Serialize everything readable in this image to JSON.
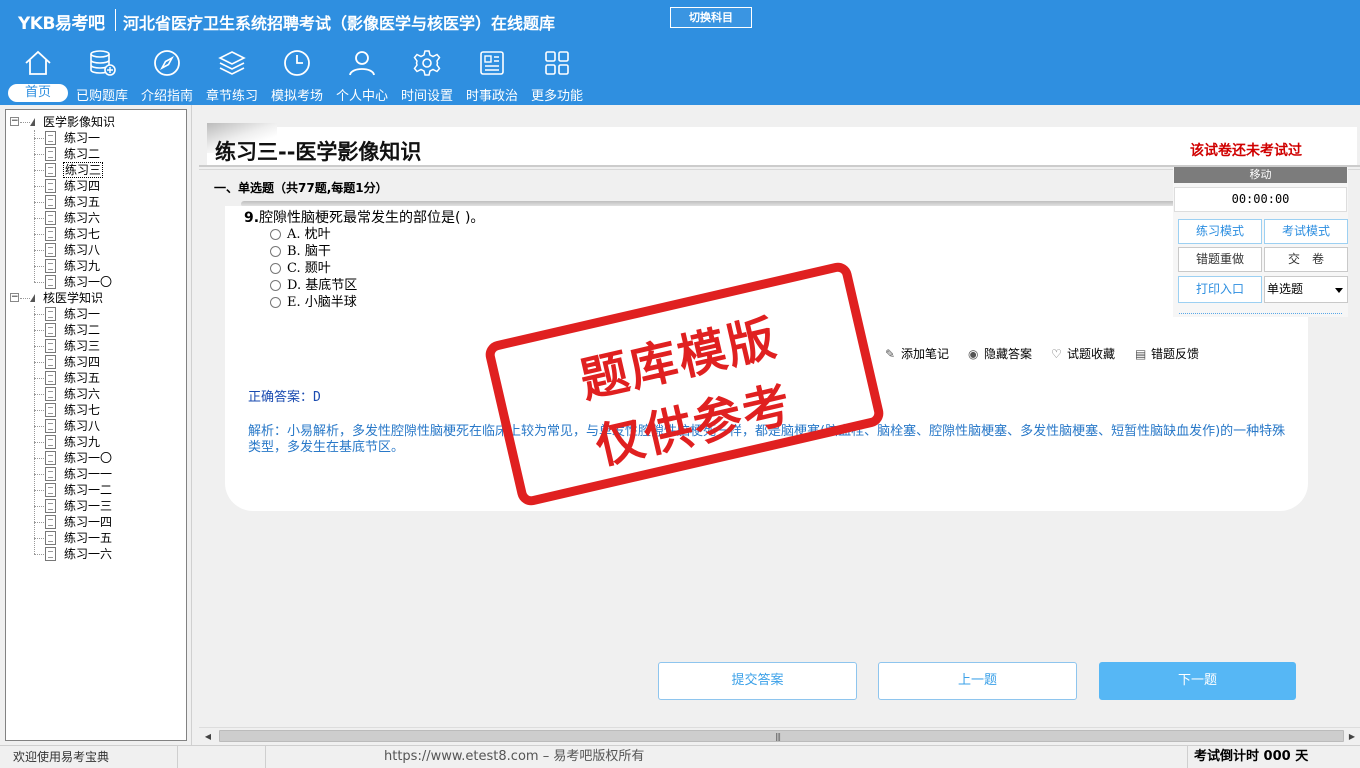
{
  "header": {
    "logo": "YKB易考吧",
    "title": "河北省医疗卫生系统招聘考试（影像医学与核医学）在线题库",
    "switch_subject": "切换科目"
  },
  "nav": [
    {
      "label": "首页",
      "icon": "home-icon",
      "active": true
    },
    {
      "label": "已购题库",
      "icon": "database-icon"
    },
    {
      "label": "介绍指南",
      "icon": "compass-icon"
    },
    {
      "label": "章节练习",
      "icon": "layers-icon"
    },
    {
      "label": "模拟考场",
      "icon": "clock-icon"
    },
    {
      "label": "个人中心",
      "icon": "user-icon"
    },
    {
      "label": "时间设置",
      "icon": "gear-icon"
    },
    {
      "label": "时事政治",
      "icon": "news-icon"
    },
    {
      "label": "更多功能",
      "icon": "grid-icon"
    }
  ],
  "tree": {
    "groups": [
      {
        "label": "医学影像知识",
        "items": [
          "练习一",
          "练习二",
          "练习三",
          "练习四",
          "练习五",
          "练习六",
          "练习七",
          "练习八",
          "练习九",
          "练习一〇"
        ]
      },
      {
        "label": "核医学知识",
        "items": [
          "练习一",
          "练习二",
          "练习三",
          "练习四",
          "练习五",
          "练习六",
          "练习七",
          "练习八",
          "练习九",
          "练习一〇",
          "练习一一",
          "练习一二",
          "练习一三",
          "练习一四",
          "练习一五",
          "练习一六"
        ]
      }
    ],
    "selected": "练习三"
  },
  "paper": {
    "title": "练习三--医学影像知识",
    "status": "该试卷还未考试过",
    "section": "一、单选题（共77题,每题1分）"
  },
  "question": {
    "number": "9.",
    "text": "腔隙性脑梗死最常发生的部位是( )。",
    "options": [
      "A. 枕叶",
      "B. 脑干",
      "C. 颞叶",
      "D. 基底节区",
      "E. 小脑半球"
    ],
    "tools": [
      {
        "label": "添加笔记",
        "icon": "pencil-icon"
      },
      {
        "label": "隐藏答案",
        "icon": "eye-icon"
      },
      {
        "label": "试题收藏",
        "icon": "heart-icon"
      },
      {
        "label": "错题反馈",
        "icon": "feedback-icon"
      }
    ],
    "answer_label": "正确答案：",
    "answer_value": "D",
    "analysis": "解析：小易解析，多发性腔隙性脑梗死在临床上较为常见，与单发性腔隙性脑梗死一样，都是脑梗塞(脑血栓、脑栓塞、腔隙性脑梗塞、多发性脑梗塞、短暂性脑缺血发作)的一种特殊类型，多发生在基底节区。"
  },
  "stamp": {
    "line1": "题库模版",
    "line2": "仅供参考"
  },
  "buttons": {
    "submit": "提交答案",
    "prev": "上一题",
    "next": "下一题"
  },
  "control": {
    "move": "移动",
    "timer": "00:00:00",
    "practice_mode": "练习模式",
    "exam_mode": "考试模式",
    "redo_wrong": "错题重做",
    "submit_paper": "交　卷",
    "print": "打印入口",
    "question_type": "单选题"
  },
  "status": {
    "welcome": "欢迎使用易考宝典",
    "copyright": "https://www.etest8.com – 易考吧版权所有",
    "countdown": "考试倒计时 000 天"
  },
  "colors": {
    "header": "#2f8fe0",
    "stamp": "#e02020",
    "status_red": "#d00000"
  }
}
